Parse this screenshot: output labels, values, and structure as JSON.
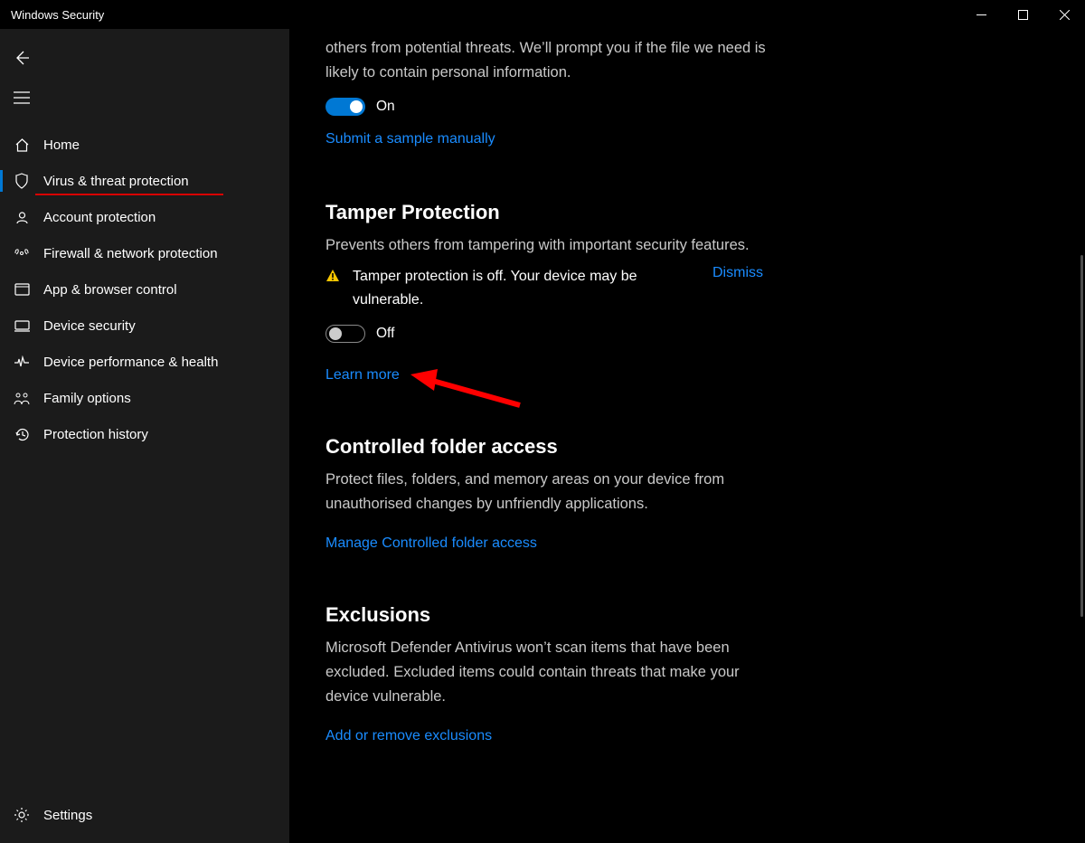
{
  "titlebar": {
    "title": "Windows Security"
  },
  "sidebar": {
    "items": [
      {
        "label": "Home"
      },
      {
        "label": "Virus & threat protection"
      },
      {
        "label": "Account protection"
      },
      {
        "label": "Firewall & network protection"
      },
      {
        "label": "App & browser control"
      },
      {
        "label": "Device security"
      },
      {
        "label": "Device performance & health"
      },
      {
        "label": "Family options"
      },
      {
        "label": "Protection history"
      }
    ],
    "settings_label": "Settings"
  },
  "main": {
    "intro_text": "others from potential threats. We’ll prompt you if the file we need is likely to contain personal information.",
    "sample_toggle_label": "On",
    "sample_link": "Submit a sample manually",
    "tamper": {
      "title": "Tamper Protection",
      "desc": "Prevents others from tampering with important security features.",
      "warning": "Tamper protection is off. Your device may be vulnerable.",
      "dismiss": "Dismiss",
      "toggle_label": "Off",
      "learn_more": "Learn more"
    },
    "cfa": {
      "title": "Controlled folder access",
      "desc": "Protect files, folders, and memory areas on your device from unauthorised changes by unfriendly applications.",
      "link": "Manage Controlled folder access"
    },
    "exclusions": {
      "title": "Exclusions",
      "desc": "Microsoft Defender Antivirus won’t scan items that have been excluded. Excluded items could contain threats that make your device vulnerable.",
      "link": "Add or remove exclusions"
    }
  }
}
